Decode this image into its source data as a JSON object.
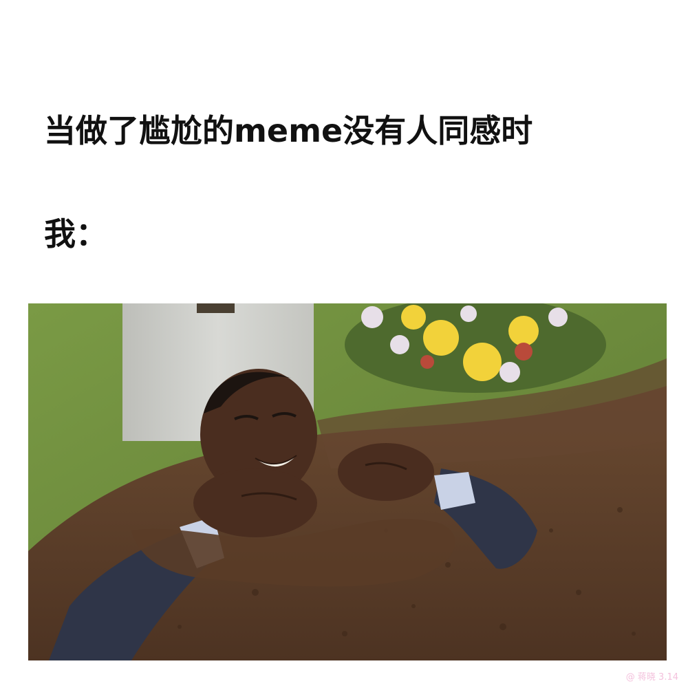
{
  "caption": {
    "line1": "当做了尴尬的meme没有人同感时",
    "line2": "我："
  },
  "watermark": {
    "text": "@ 蒋晓 3.14"
  },
  "photo": {
    "colors": {
      "grass": "#6f8f3e",
      "soil": "#5b3d28",
      "headstone": "#cfd0cc",
      "suit": "#2f3548",
      "skin": "#4a2d1f"
    }
  }
}
